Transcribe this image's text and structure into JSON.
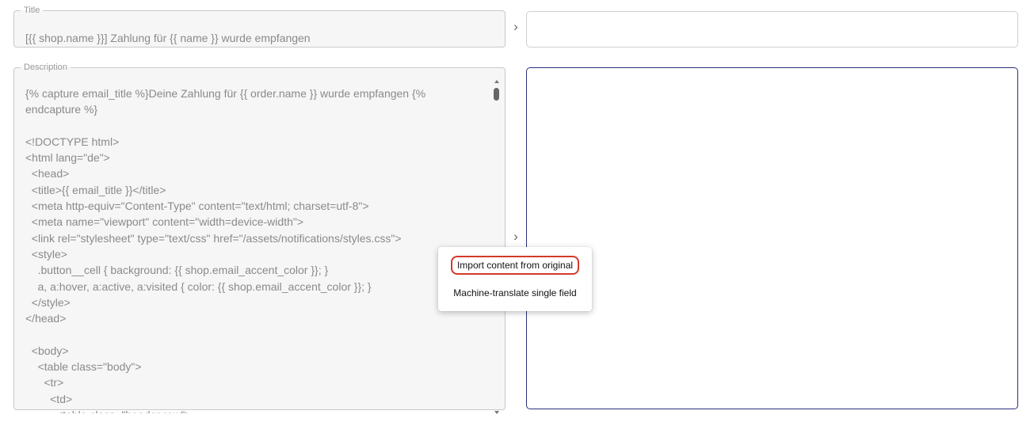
{
  "title_field": {
    "legend": "Title",
    "value": "[{{ shop.name }}] Zahlung für {{ name }} wurde empfangen"
  },
  "description_field": {
    "legend": "Description",
    "value": "{% capture email_title %}Deine Zahlung für {{ order.name }} wurde empfangen {%\nendcapture %}\n\n<!DOCTYPE html>\n<html lang=\"de\">\n  <head>\n  <title>{{ email_title }}</title>\n  <meta http-equiv=\"Content-Type\" content=\"text/html; charset=utf-8\">\n  <meta name=\"viewport\" content=\"width=device-width\">\n  <link rel=\"stylesheet\" type=\"text/css\" href=\"/assets/notifications/styles.css\">\n  <style>\n    .button__cell { background: {{ shop.email_accent_color }}; }\n    a, a:hover, a:active, a:visited { color: {{ shop.email_accent_color }}; }\n  </style>\n</head>\n\n  <body>\n    <table class=\"body\">\n      <tr>\n        <td>\n          <table class=\"header row\">"
  },
  "icons": {
    "chevron": "›"
  },
  "context_menu": {
    "items": [
      {
        "label": "Import content from original",
        "highlighted": true
      },
      {
        "label": "Machine-translate single field",
        "highlighted": false
      }
    ]
  },
  "colors": {
    "highlight_ring": "#d43a2a",
    "focused_border": "#2c2e78"
  }
}
